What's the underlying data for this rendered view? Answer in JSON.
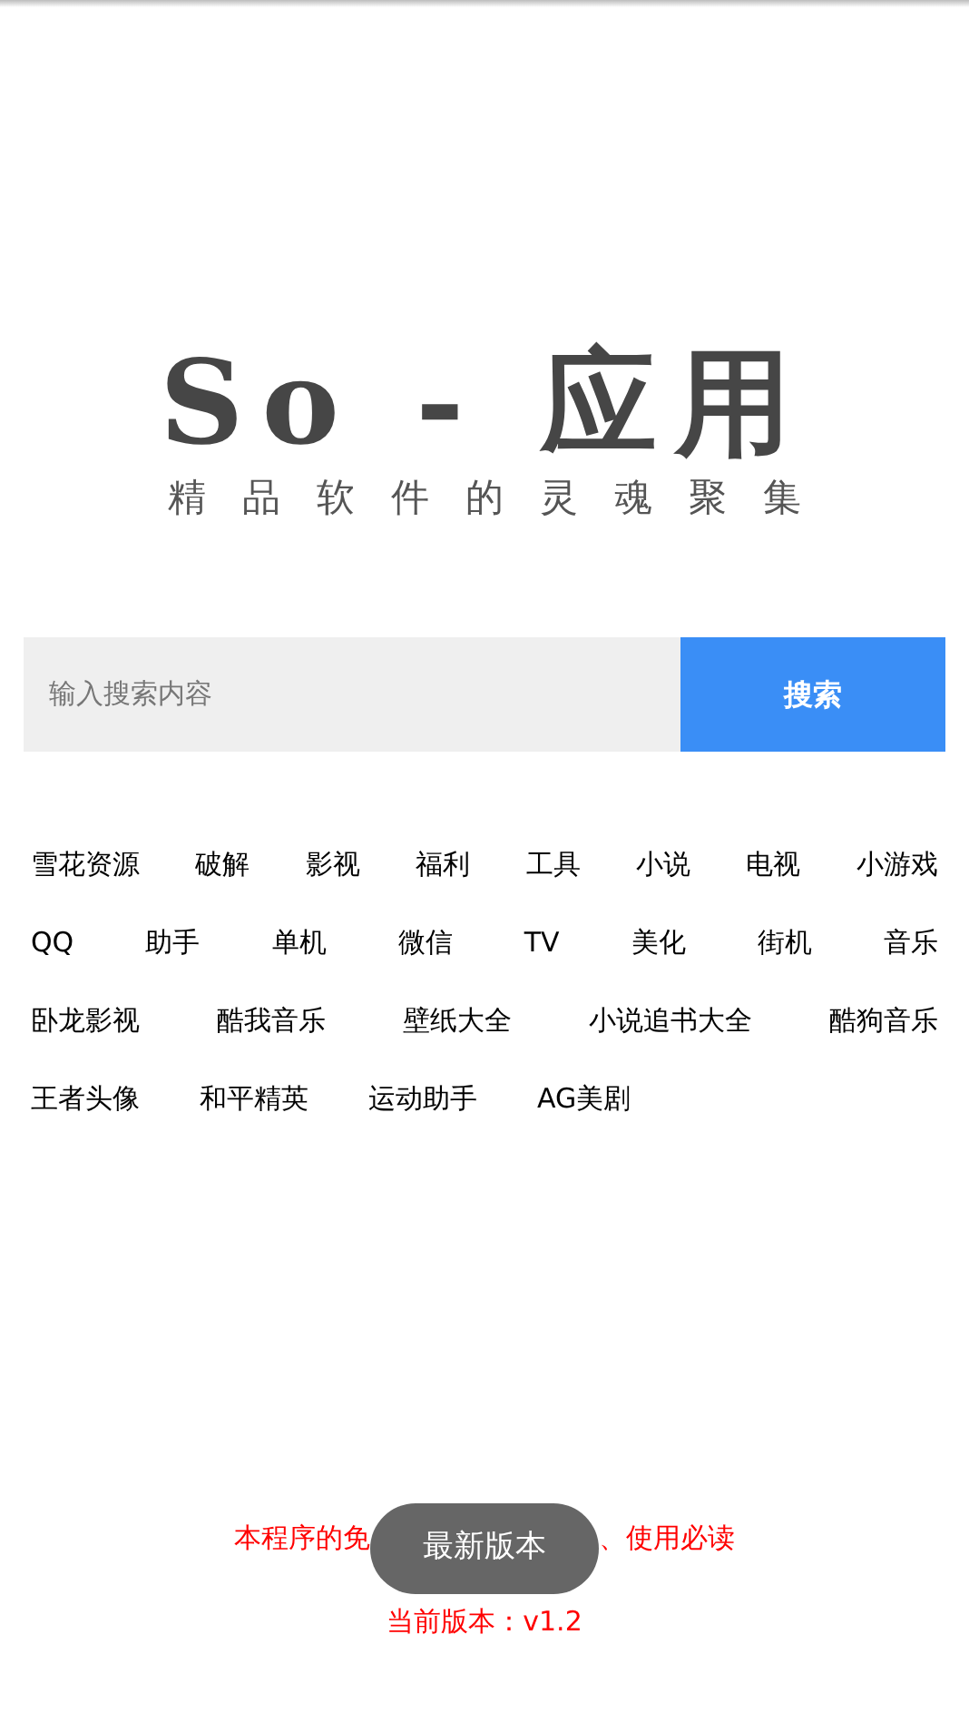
{
  "logo": {
    "title": "So - 应用",
    "subtitle": "精品软件的灵魂聚集"
  },
  "search": {
    "placeholder": "输入搜索内容",
    "button": "搜索"
  },
  "tag_rows": [
    [
      "雪花资源",
      "破解",
      "影视",
      "福利",
      "工具",
      "小说",
      "电视",
      "小游戏"
    ],
    [
      "QQ",
      "助手",
      "单机",
      "微信",
      "TV",
      "美化",
      "街机",
      "音乐"
    ],
    [
      "卧龙影视",
      "酷我音乐",
      "壁纸大全",
      "小说追书大全",
      "酷狗音乐"
    ],
    [
      "王者头像",
      "和平精英",
      "运动助手",
      "AG美剧"
    ]
  ],
  "footer": {
    "notice_parts": [
      "本程序的免",
      "、使用必读"
    ],
    "version": "当前版本：v1.2"
  },
  "toast": "最新版本"
}
